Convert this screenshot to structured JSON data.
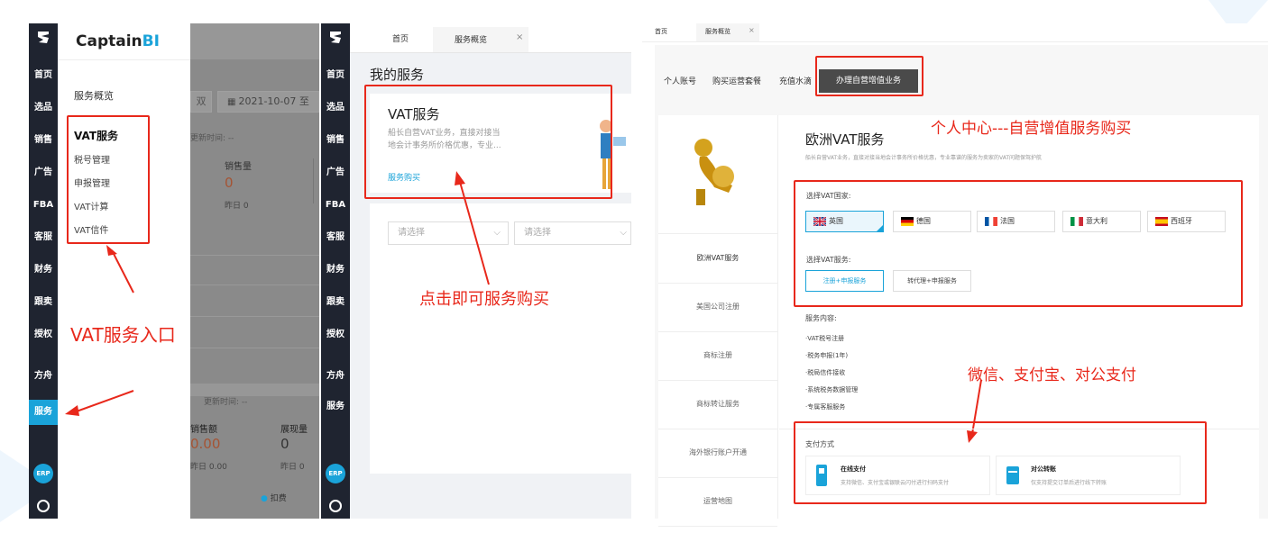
{
  "panel1": {
    "rail_items": [
      "首页",
      "选品",
      "销售",
      "广告",
      "FBA",
      "客服",
      "财务",
      "跟卖",
      "授权",
      "方舟",
      "服务"
    ],
    "rail_active": "服务",
    "erp_label": "ERP",
    "brand_name": "CaptainBI",
    "brand_black": "Captain",
    "brand_blue": "BI",
    "menu_overview": "服务概览",
    "menu_group_title": "VAT服务",
    "menu_items": [
      "税号管理",
      "申报管理",
      "VAT计算",
      "VAT信件"
    ],
    "bg_date": "2021-10-07 至",
    "bg_date_prefix": "双",
    "bg_update_1": "更新时间: --",
    "bg_sales_qty_label": "销售量",
    "bg_sales_qty_value": "0",
    "bg_yesterday_1": "昨日  0",
    "bg_update_2": "更新时间: --",
    "bg_sales_amount_label": "销售额",
    "bg_sales_amount_value": "0.00",
    "bg_yesterday_2": "昨日  0.00",
    "bg_impr_label": "展现量",
    "bg_impr_value": "0",
    "bg_yesterday_3": "昨日  0",
    "bg_deduct": "扣费",
    "annotation": "VAT服务入口"
  },
  "panel2": {
    "rail_items": [
      "首页",
      "选品",
      "销售",
      "广告",
      "FBA",
      "客服",
      "财务",
      "跟卖",
      "授权",
      "方舟",
      "服务"
    ],
    "erp_label": "ERP",
    "tabs": [
      "首页",
      "服务概览"
    ],
    "tab_close": "×",
    "section_title": "我的服务",
    "card_title": "VAT服务",
    "card_desc_line1": "船长自营VAT业务，直接对接当",
    "card_desc_line2": "地会计事务所价格优惠，专业...",
    "card_link": "服务购买",
    "select1_placeholder": "请选择",
    "select2_placeholder": "请选择",
    "annotation": "点击即可服务购买"
  },
  "panel3": {
    "tabs": [
      "首页",
      "服务概览"
    ],
    "tab_close": "×",
    "top_tabs": [
      "个人账号",
      "购买运营套餐",
      "充值水滴",
      "办理自营增值业务"
    ],
    "top_tab_active": "办理自营增值业务",
    "left_menu": [
      "欧洲VAT服务",
      "美国公司注册",
      "商标注册",
      "商标转让服务",
      "海外银行账户开通",
      "运营地图"
    ],
    "left_menu_active": "欧洲VAT服务",
    "annotation_title": "个人中心---自营增值服务购买",
    "product_title": "欧洲VAT服务",
    "product_desc": "船长自营VAT业务，直接对接当地会计事务所价格优惠，专业靠谱的服务为卖家的VAT问题保驾护航",
    "country_label": "选择VAT国家:",
    "countries": [
      "英国",
      "德国",
      "法国",
      "意大利",
      "西班牙"
    ],
    "country_selected": "英国",
    "service_label": "选择VAT服务:",
    "services": [
      "注册+申报服务",
      "转代理+申报服务"
    ],
    "service_selected": "注册+申报服务",
    "content_label": "服务内容:",
    "content_items": [
      "·VAT税号注册",
      "·税务申报(1年)",
      "·税局信件接收",
      "·系统税务数据管理",
      "·专属客服服务"
    ],
    "annotation_pay": "微信、支付宝、对公支付",
    "pay_label": "支付方式",
    "pay_online_title": "在线支付",
    "pay_online_desc": "支持微信、支付宝或银联云闪付进行扫码支付",
    "pay_bank_title": "对公转账",
    "pay_bank_desc": "仅支持提交订单后进行线下转账"
  },
  "colors": {
    "accent": "#1aa3d9",
    "rail": "#1f2430",
    "annotation": "#e8281b",
    "tab_active_bg": "#4a4a4a"
  }
}
